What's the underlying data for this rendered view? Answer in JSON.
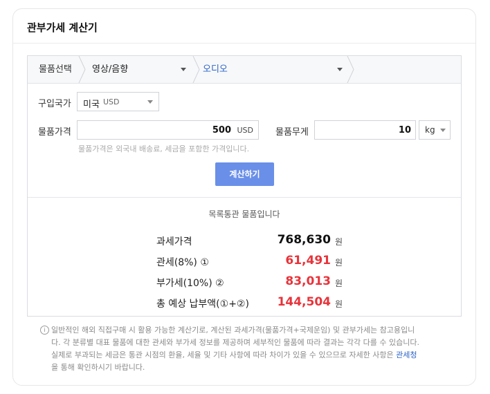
{
  "title": "관부가세 계산기",
  "breadcrumb": {
    "label": "물품선택",
    "category": "영상/음향",
    "subcategory": "오디오"
  },
  "form": {
    "country_label": "구입국가",
    "country_value": "미국",
    "country_currency": "USD",
    "price_label": "물품가격",
    "price_value": "500",
    "price_unit": "USD",
    "weight_label": "물품무게",
    "weight_value": "10",
    "weight_unit": "kg",
    "hint": "물품가격은 외국내 배송료, 세금을 포함한 가격입니다.",
    "calc_button": "계산하기"
  },
  "result": {
    "heading": "목록통관 물품입니다",
    "rows": [
      {
        "label": "과세가격",
        "value": "768,630",
        "unit": "원"
      },
      {
        "label": "관세(8%) ①",
        "value": "61,491",
        "unit": "원"
      },
      {
        "label": "부가세(10%) ②",
        "value": "83,013",
        "unit": "원"
      },
      {
        "label": "총 예상 납부액(①+②)",
        "value": "144,504",
        "unit": "원"
      }
    ]
  },
  "note": {
    "line1": "일반적인 해외 직접구매 시 활용 가능한 계산기로, 계산된 과세가격(물품가격+국제운임) 및 관부가세는 참고용입니",
    "line2": "다. 각 분류별 대표 물품에 대한 관세와 부가세 정보를 제공하며 세부적인 물품에 따라 결과는 각각 다를 수 있습니다.",
    "line3": "실제로 부과되는 세금은 통관 시점의 환율, 세율 및 기타 사항에 따라 차이가 있을 수 있으므로 자세한 사항은 ",
    "link": "관세청",
    "line4": "을 통해 확인하시기 바랍니다."
  },
  "colors": {
    "accent_blue": "#2b63c6",
    "button_bg": "#6a8fe8",
    "result_red": "#e8333a"
  },
  "icons": {
    "info": "info-icon",
    "dropdown": "chevron-down-icon"
  }
}
